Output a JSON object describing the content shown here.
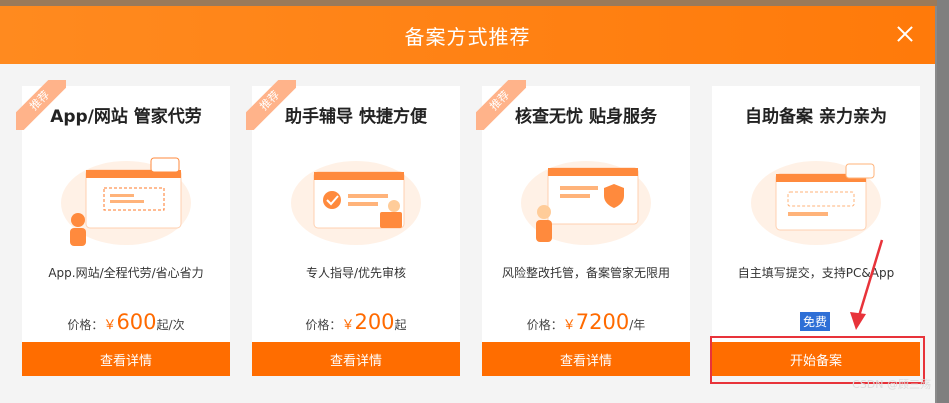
{
  "dialog": {
    "title": "备案方式推荐",
    "close_icon": "close-icon"
  },
  "cards": [
    {
      "ribbon": "推荐",
      "title": "App/网站 管家代劳",
      "desc": "App.网站/全程代劳/省心省力",
      "price_prefix": "价格：",
      "price_symbol": "￥",
      "price_value": "600",
      "price_suffix": "起/次",
      "button": "查看详情"
    },
    {
      "ribbon": "推荐",
      "title": "助手辅导 快捷方便",
      "desc": "专人指导/优先审核",
      "price_prefix": "价格：",
      "price_symbol": "￥",
      "price_value": "200",
      "price_suffix": "起",
      "button": "查看详情"
    },
    {
      "ribbon": "推荐",
      "title": "核查无忧 贴身服务",
      "desc": "风险整改托管，备案管家无限用",
      "price_prefix": "价格：",
      "price_symbol": "￥",
      "price_value": "7200",
      "price_suffix": "/年",
      "button": "查看详情"
    },
    {
      "title": "自助备案 亲力亲为",
      "desc": "自主填写提交，支持PC&App",
      "badge": "免费",
      "button": "开始备案"
    }
  ],
  "watermark": "CSDN @顾三殇",
  "colors": {
    "accent": "#ff6d00",
    "highlight": "#e8333a",
    "badge": "#2e6fd6"
  }
}
